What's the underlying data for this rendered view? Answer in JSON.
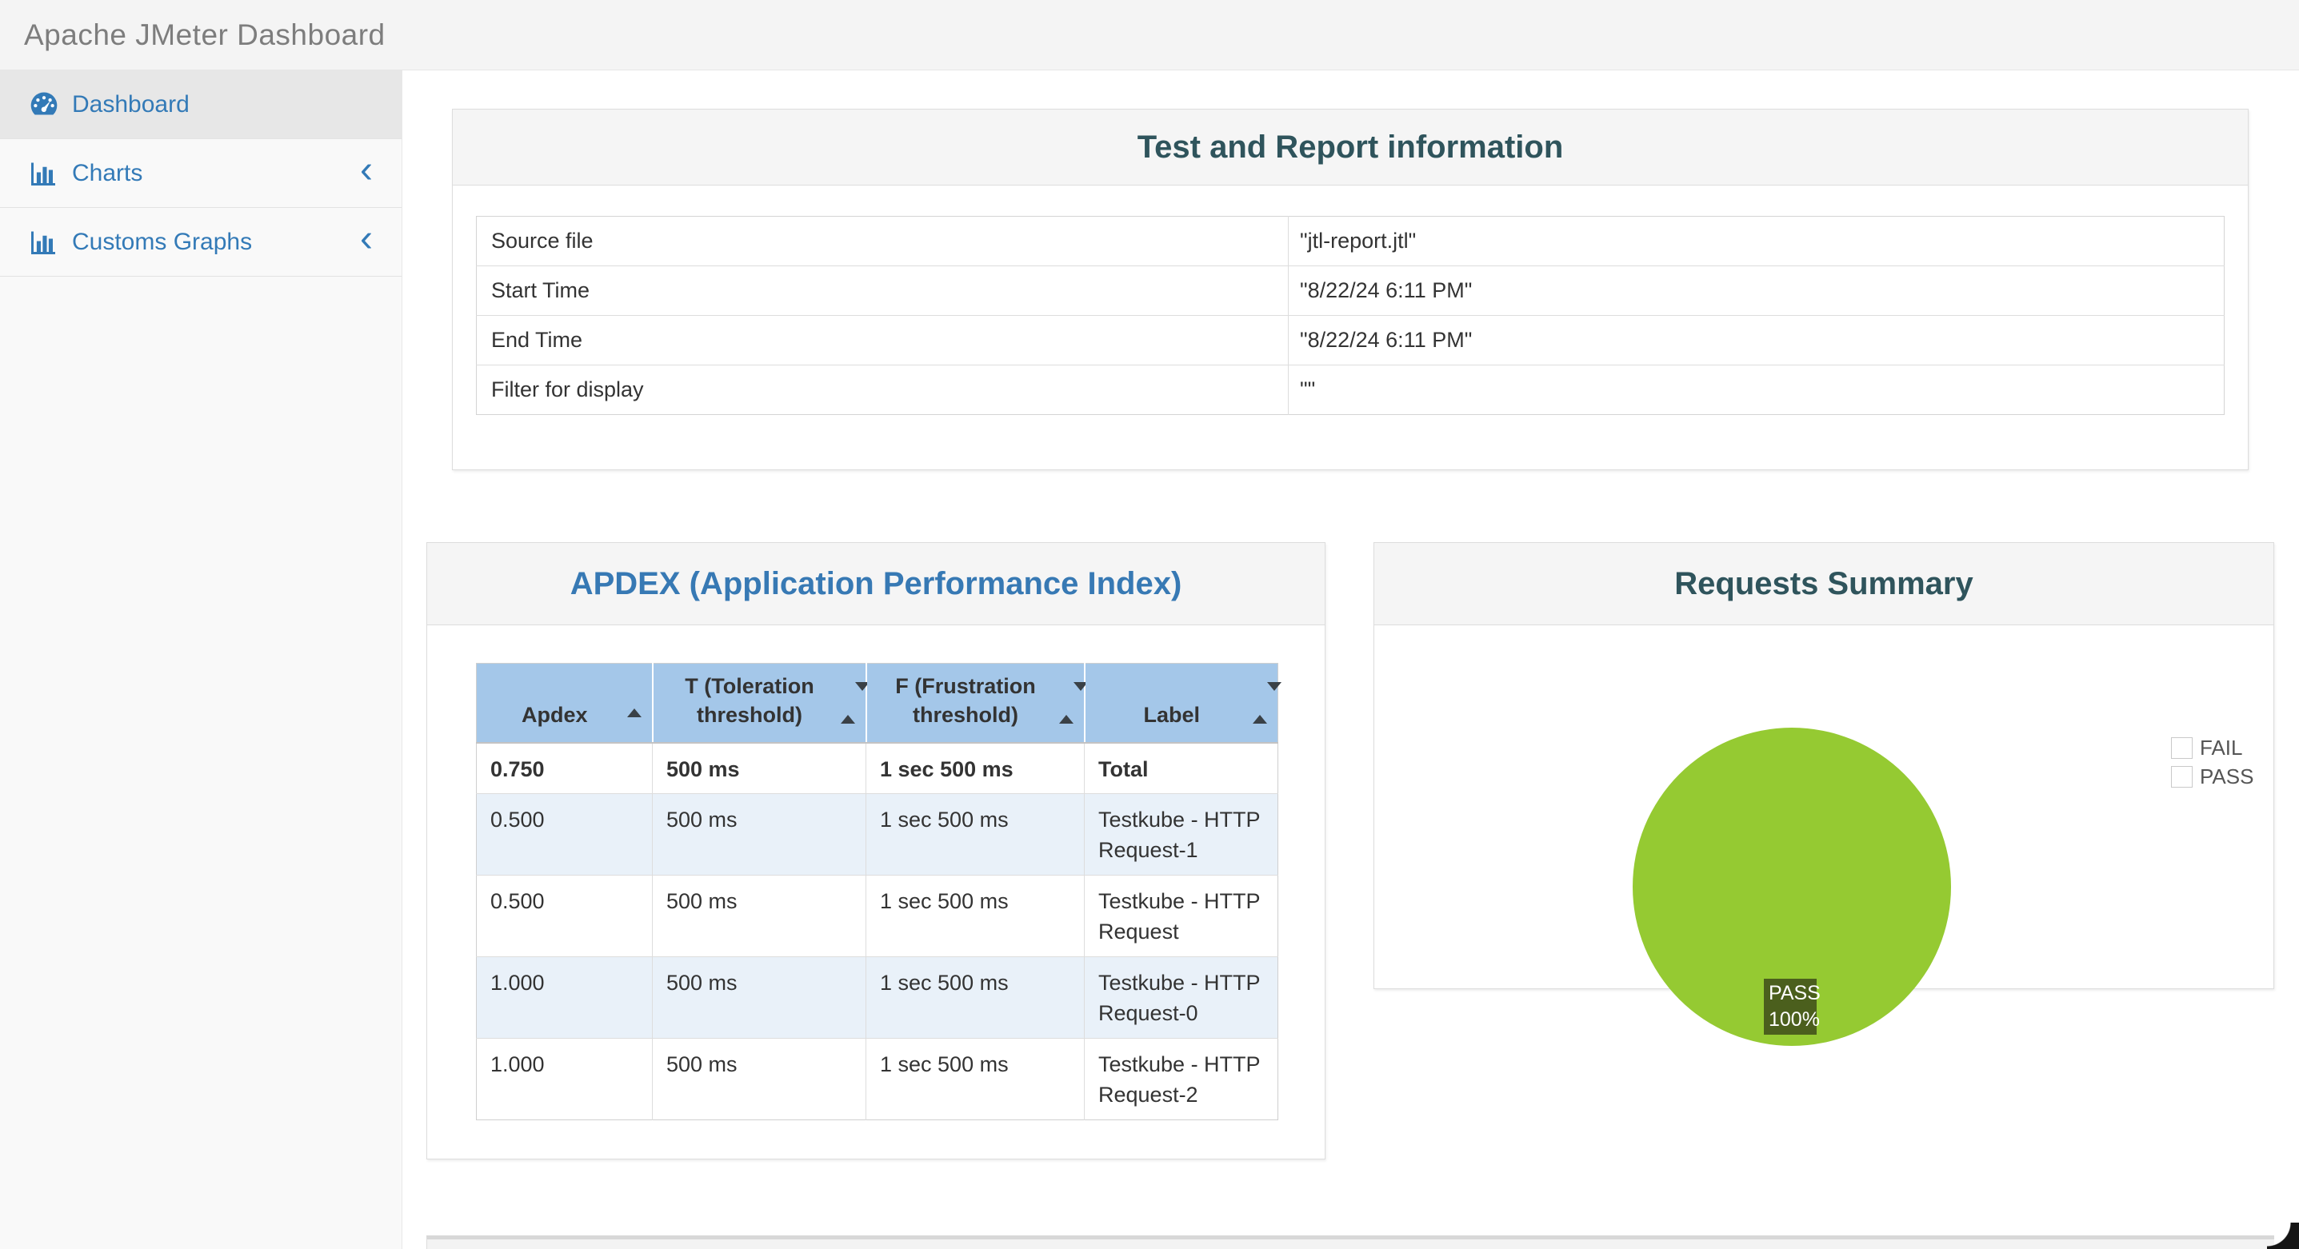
{
  "app": {
    "title": "Apache JMeter Dashboard"
  },
  "colors": {
    "accent_blue": "#337ab7",
    "title_teal": "#2f545c",
    "title_blue": "#3779b4",
    "table_header_blue": "#a4c7e9",
    "row_stripe_blue": "#e9f1f9",
    "pass_green": "#95ca32",
    "fail_red": "#fa6d5a",
    "pie_label_bg": "#4b5f1d"
  },
  "sidebar": {
    "chevron": "‹",
    "items": [
      {
        "label": "Dashboard",
        "icon": "dashboard-icon",
        "active": true,
        "collapsible": false
      },
      {
        "label": "Charts",
        "icon": "bar-chart-icon",
        "active": false,
        "collapsible": true
      },
      {
        "label": "Customs Graphs",
        "icon": "bar-chart-icon",
        "active": false,
        "collapsible": true
      }
    ]
  },
  "panels": {
    "test_info": {
      "title": "Test and Report information",
      "rows": [
        {
          "label": "Source file",
          "value": "\"jtl-report.jtl\""
        },
        {
          "label": "Start Time",
          "value": "\"8/22/24 6:11 PM\""
        },
        {
          "label": "End Time",
          "value": "\"8/22/24 6:11 PM\""
        },
        {
          "label": "Filter for display",
          "value": "\"\""
        }
      ]
    },
    "apdex": {
      "title": "APDEX (Application Performance Index)",
      "columns": [
        {
          "label": "Apdex",
          "sort": "asc"
        },
        {
          "label": "T (Toleration threshold)",
          "sort": "both"
        },
        {
          "label": "F (Frustration threshold)",
          "sort": "both"
        },
        {
          "label": "Label",
          "sort": "both"
        }
      ],
      "rows": [
        [
          "0.750",
          "500 ms",
          "1 sec 500 ms",
          "Total"
        ],
        [
          "0.500",
          "500 ms",
          "1 sec 500 ms",
          "Testkube - HTTP Request-1"
        ],
        [
          "0.500",
          "500 ms",
          "1 sec 500 ms",
          "Testkube - HTTP Request"
        ],
        [
          "1.000",
          "500 ms",
          "1 sec 500 ms",
          "Testkube - HTTP Request-0"
        ],
        [
          "1.000",
          "500 ms",
          "1 sec 500 ms",
          "Testkube - HTTP Request-2"
        ]
      ]
    },
    "requests_summary": {
      "title": "Requests Summary",
      "chart_data": {
        "type": "pie",
        "legend_position": "top-right",
        "slices": [
          {
            "label": "FAIL",
            "value": 0,
            "color": "#fa6d5a"
          },
          {
            "label": "PASS",
            "value": 100,
            "color": "#95ca32"
          }
        ],
        "center_label_lines": [
          "PASS",
          "100%"
        ]
      }
    }
  }
}
